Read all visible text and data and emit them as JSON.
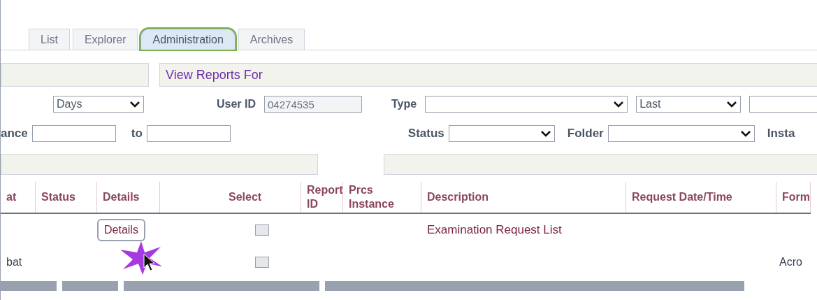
{
  "tabs": [
    {
      "label": "List",
      "selected": false
    },
    {
      "label": "Explorer",
      "selected": false
    },
    {
      "label": "Administration",
      "selected": true
    },
    {
      "label": "Archives",
      "selected": false
    }
  ],
  "section_title": "View Reports For",
  "unit_select": {
    "value": "Days"
  },
  "user_id": {
    "label": "User ID",
    "value": "04274535"
  },
  "type": {
    "label": "Type"
  },
  "last_select": {
    "value": "Last"
  },
  "instance": {
    "label": "ance"
  },
  "to": {
    "label": "to"
  },
  "status": {
    "label": "Status"
  },
  "folder": {
    "label": "Folder"
  },
  "instance_cut": {
    "label": "Insta"
  },
  "left_table": {
    "columns": [
      "at",
      "Status",
      "Details"
    ],
    "rows": [
      {
        "details_button": "Details"
      },
      {
        "format": "bat"
      }
    ]
  },
  "right_table": {
    "columns": [
      "Select",
      "Report ID",
      "Prcs Instance",
      "Description",
      "Request Date/Time",
      "Form"
    ],
    "rows": [
      {
        "checked": false,
        "description": "Examination Request List"
      },
      {
        "checked": false,
        "format": "Acro"
      }
    ]
  }
}
